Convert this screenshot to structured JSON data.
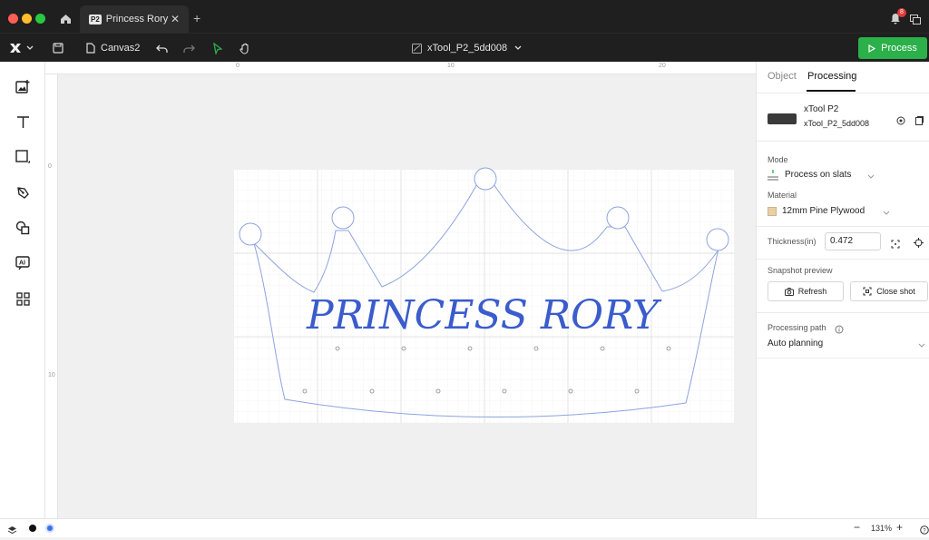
{
  "tab": {
    "badge": "P2",
    "title": "Princess Rory"
  },
  "notifications": {
    "count": "8"
  },
  "toolbar": {
    "canvas_name": "Canvas2",
    "device_name": "xTool_P2_5dd008",
    "process_label": "Process"
  },
  "rulers": {
    "top_labels": [
      "0",
      "10",
      "20"
    ],
    "left_labels": [
      "0",
      "10"
    ]
  },
  "canvas": {
    "text": "PRINCESS RORY",
    "text_color": "#3a5ccc",
    "outline_color": "#8ea3e0"
  },
  "panel": {
    "tabs": [
      "Object",
      "Processing"
    ],
    "active_tab": "Processing",
    "device_model": "xTool P2",
    "device_id": "xTool_P2_5dd008",
    "mode_label": "Mode",
    "mode_value": "Process on slats",
    "material_label": "Material",
    "material_value": "12mm Pine Plywood",
    "thickness_label": "Thickness(in)",
    "thickness_value": "0.472",
    "snapshot_label": "Snapshot preview",
    "refresh_label": "Refresh",
    "close_shot_label": "Close shot",
    "path_label": "Processing path",
    "path_value": "Auto planning"
  },
  "status": {
    "zoom": "131%"
  },
  "colors": {
    "accent_green": "#2bb04a",
    "selection_blue": "#3a6ff0"
  }
}
